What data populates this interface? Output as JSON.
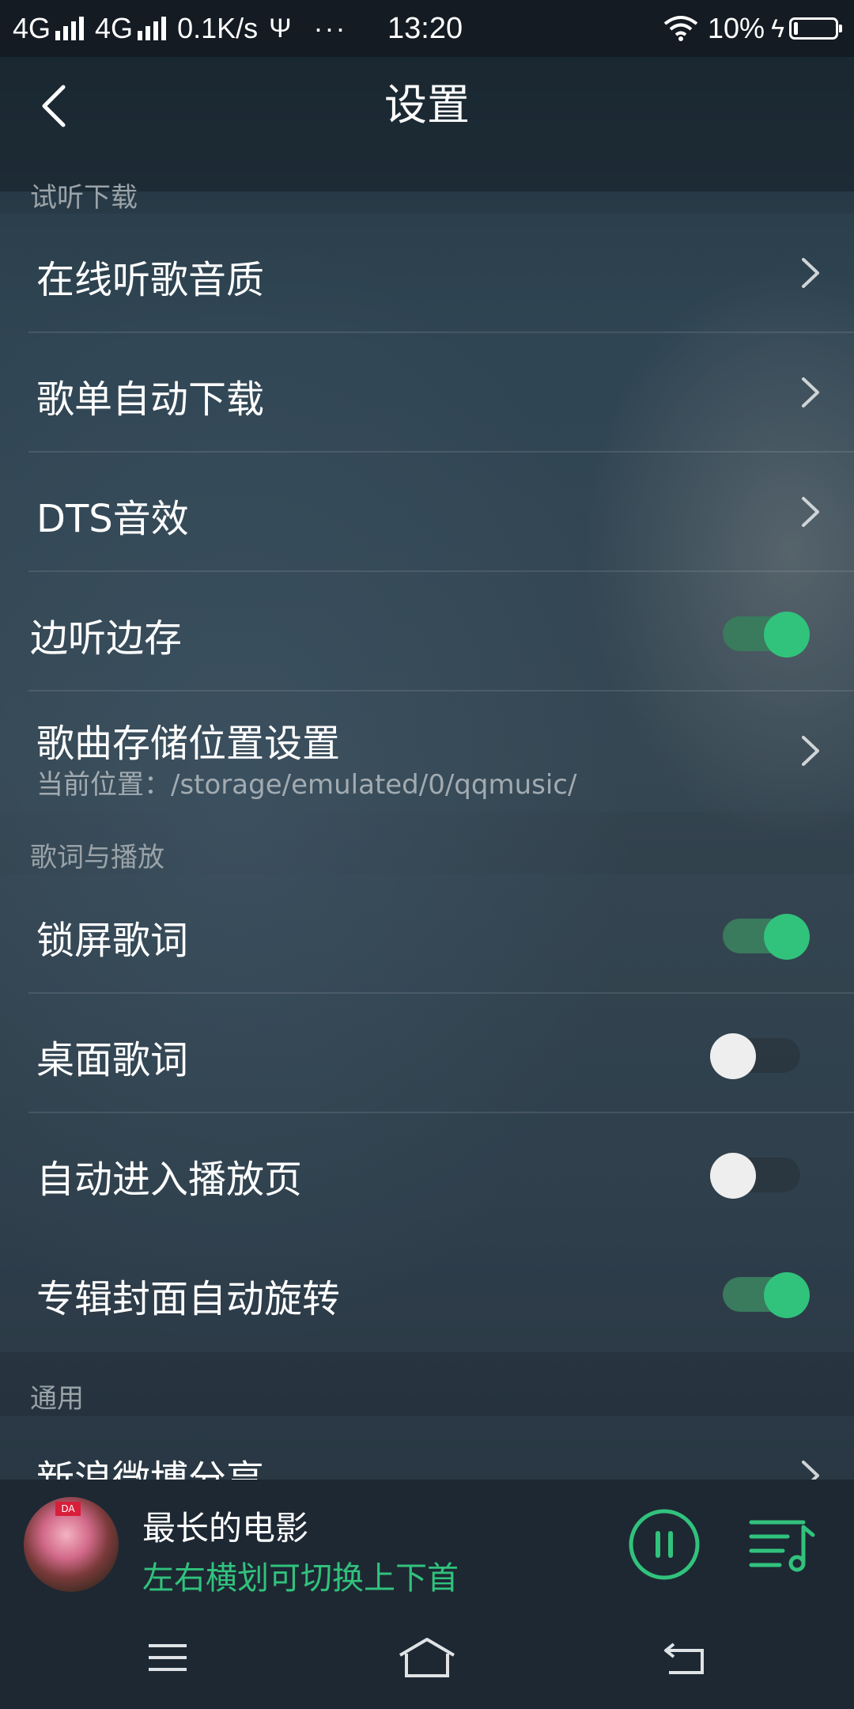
{
  "status_bar": {
    "network1": "4G",
    "network2": "4G",
    "speed": "0.1K/s",
    "usb_icon": "usb-icon",
    "dots": "···",
    "time": "13:20",
    "battery": "10%"
  },
  "header": {
    "title": "设置",
    "back_icon": "chevron-left-icon"
  },
  "sections": {
    "listen_download": {
      "title": "试听下载",
      "items": {
        "online_quality": "在线听歌音质",
        "playlist_auto_download": "歌单自动下载",
        "dts": "DTS音效",
        "cache_while_listening": "边听边存",
        "storage_location": "歌曲存储位置设置",
        "storage_path": "当前位置：/storage/emulated/0/qqmusic/"
      },
      "toggles": {
        "cache_while_listening": true
      }
    },
    "lyrics_playback": {
      "title": "歌词与播放",
      "items": {
        "lock_screen_lyrics": "锁屏歌词",
        "desktop_lyrics": "桌面歌词",
        "auto_enter_player": "自动进入播放页",
        "album_cover_rotation": "专辑封面自动旋转"
      },
      "toggles": {
        "lock_screen_lyrics": true,
        "desktop_lyrics": false,
        "auto_enter_player": false,
        "album_cover_rotation": true
      }
    },
    "general": {
      "title": "通用",
      "items": {
        "weibo_share": "新浪微博分享"
      }
    }
  },
  "mini_player": {
    "song_title": "最长的电影",
    "hint": "左右横划可切换上下首",
    "album_badge": "DA"
  },
  "colors": {
    "accent": "#31c27c",
    "status_bar_bg": "#141b22",
    "player_bg": "#1d2833"
  }
}
